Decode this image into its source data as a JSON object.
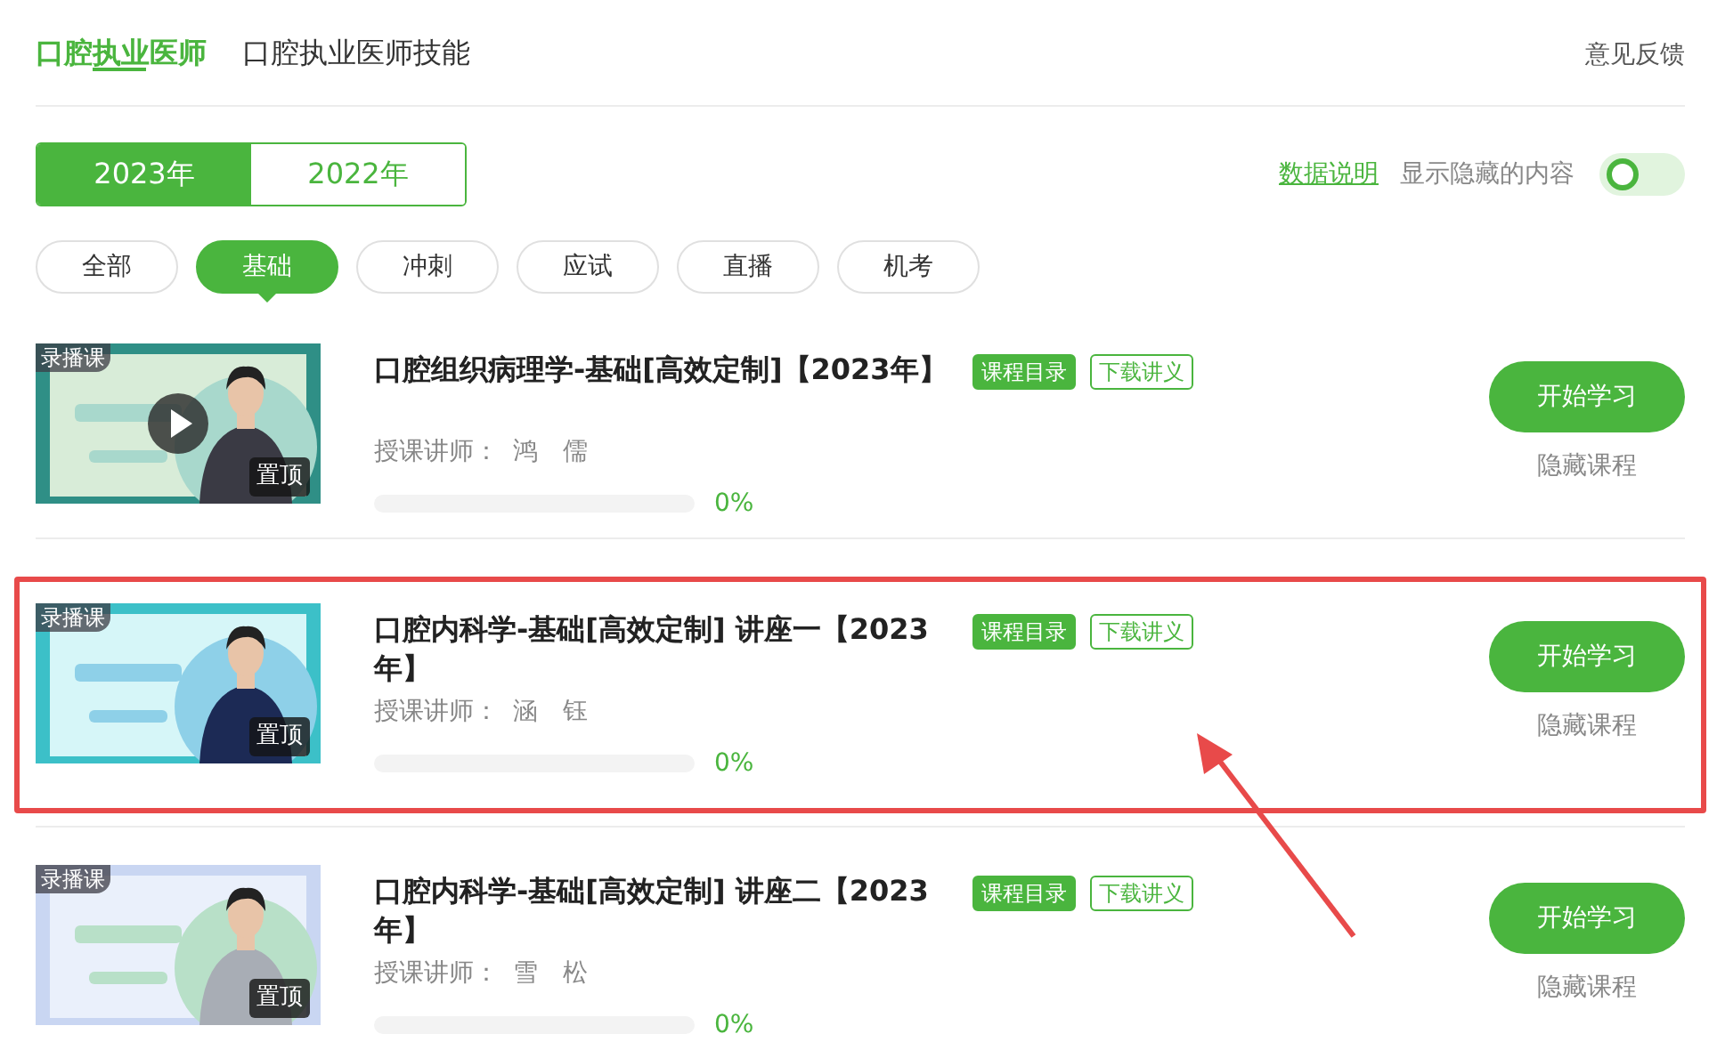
{
  "top_tabs": [
    {
      "label": "口腔执业医师",
      "selected": true
    },
    {
      "label": "口腔执业医师技能",
      "selected": false
    }
  ],
  "feedback": "意见反馈",
  "years": [
    {
      "label": "2023年",
      "selected": true
    },
    {
      "label": "2022年",
      "selected": false
    }
  ],
  "data_note": "数据说明",
  "show_hidden": {
    "label": "显示隐藏的内容",
    "on": false
  },
  "filters": [
    {
      "label": "全部",
      "selected": false
    },
    {
      "label": "基础",
      "selected": true
    },
    {
      "label": "冲刺",
      "selected": false
    },
    {
      "label": "应试",
      "selected": false
    },
    {
      "label": "直播",
      "selected": false
    },
    {
      "label": "机考",
      "selected": false
    }
  ],
  "courses": [
    {
      "badge": "录播课",
      "pin": "置顶",
      "play_button": true,
      "highlighted": false,
      "title": "口腔组织病理学-基础[高效定制]【2023年】",
      "tags": [
        "课程目录",
        "下载讲义"
      ],
      "teacher_label": "授课讲师：",
      "teacher": "鸿　儒",
      "progress": "0%",
      "start": "开始学习",
      "hide": "隐藏课程"
    },
    {
      "badge": "录播课",
      "pin": "置顶",
      "play_button": false,
      "highlighted": true,
      "title": "口腔内科学-基础[高效定制] 讲座一【2023年】",
      "tags": [
        "课程目录",
        "下载讲义"
      ],
      "teacher_label": "授课讲师：",
      "teacher": "涵　钰",
      "progress": "0%",
      "start": "开始学习",
      "hide": "隐藏课程"
    },
    {
      "badge": "录播课",
      "pin": "置顶",
      "play_button": false,
      "highlighted": false,
      "title": "口腔内科学-基础[高效定制] 讲座二【2023年】",
      "tags": [
        "课程目录",
        "下载讲义"
      ],
      "teacher_label": "授课讲师：",
      "teacher": "雪　松",
      "progress": "0%",
      "start": "开始学习",
      "hide": "隐藏课程"
    }
  ]
}
